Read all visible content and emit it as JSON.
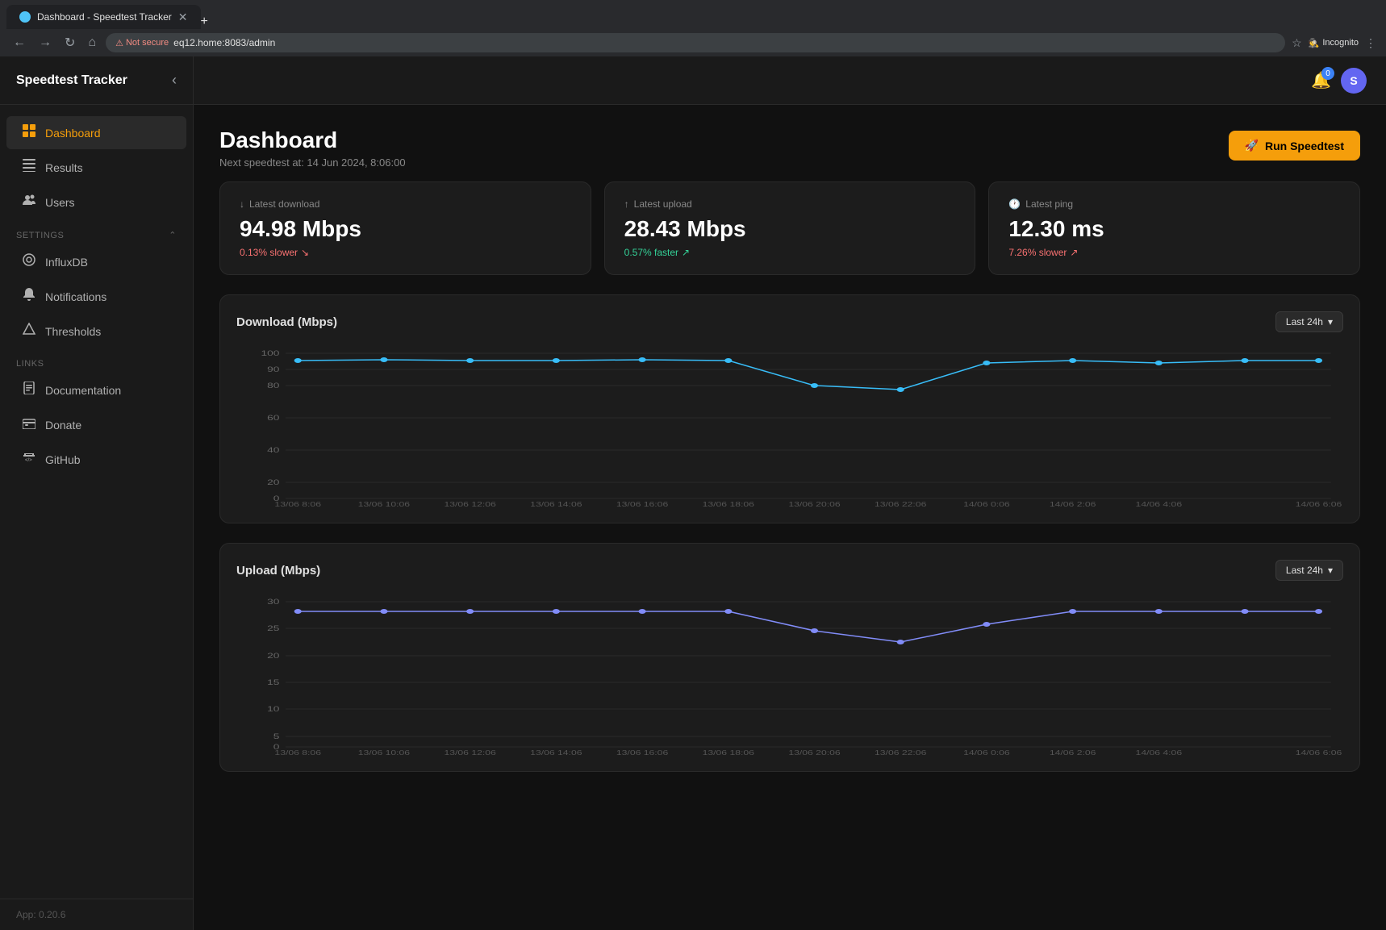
{
  "browser": {
    "tab_title": "Dashboard - Speedtest Tracker",
    "url_not_secure": "Not secure",
    "url": "eq12.home:8083/admin",
    "incognito_label": "Incognito"
  },
  "sidebar": {
    "title": "Speedtest Tracker",
    "nav_items": [
      {
        "id": "dashboard",
        "label": "Dashboard",
        "icon": "grid",
        "active": true
      },
      {
        "id": "results",
        "label": "Results",
        "icon": "list"
      },
      {
        "id": "users",
        "label": "Users",
        "icon": "users"
      }
    ],
    "settings_label": "Settings",
    "settings_items": [
      {
        "id": "influxdb",
        "label": "InfluxDB",
        "icon": "db"
      },
      {
        "id": "notifications",
        "label": "Notifications",
        "icon": "bell"
      },
      {
        "id": "thresholds",
        "label": "Thresholds",
        "icon": "triangle"
      }
    ],
    "links_label": "Links",
    "links_items": [
      {
        "id": "documentation",
        "label": "Documentation",
        "icon": "book"
      },
      {
        "id": "donate",
        "label": "Donate",
        "icon": "heart"
      },
      {
        "id": "github",
        "label": "GitHub",
        "icon": "code"
      }
    ],
    "footer": "App: 0.20.6"
  },
  "header": {
    "title": "Dashboard",
    "subtitle": "Next speedtest at: 14 Jun 2024, 8:06:00",
    "run_button": "Run Speedtest"
  },
  "stats": [
    {
      "label": "Latest download",
      "value": "94.98 Mbps",
      "change": "0.13% slower",
      "change_type": "slower",
      "icon": "download"
    },
    {
      "label": "Latest upload",
      "value": "28.43 Mbps",
      "change": "0.57% faster",
      "change_type": "faster",
      "icon": "upload"
    },
    {
      "label": "Latest ping",
      "value": "12.30 ms",
      "change": "7.26% slower",
      "change_type": "slower",
      "icon": "clock"
    }
  ],
  "download_chart": {
    "title": "Download (Mbps)",
    "filter": "Last 24h",
    "y_labels": [
      "100",
      "90",
      "80",
      "60",
      "40",
      "20",
      "0"
    ],
    "x_labels": [
      "13/06 8:06",
      "13/06 10:06",
      "13/06 12:06",
      "13/06 14:06",
      "13/06 16:06",
      "13/06 18:06",
      "13/06 20:06",
      "13/06 22:06",
      "14/06 0:06",
      "14/06 2:06",
      "14/06 4:06",
      "14/06 6:06"
    ],
    "color": "#38bdf8"
  },
  "upload_chart": {
    "title": "Upload (Mbps)",
    "filter": "Last 24h",
    "y_labels": [
      "30",
      "25",
      "20",
      "15",
      "10",
      "5",
      "0"
    ],
    "x_labels": [
      "13/06 8:06",
      "13/06 10:06",
      "13/06 12:06",
      "13/06 14:06",
      "13/06 16:06",
      "13/06 18:06",
      "13/06 20:06",
      "13/06 22:06",
      "14/06 0:06",
      "14/06 2:06",
      "14/06 4:06",
      "14/06 6:06"
    ],
    "color": "#818cf8"
  },
  "notification_count": "0",
  "user_initial": "S"
}
